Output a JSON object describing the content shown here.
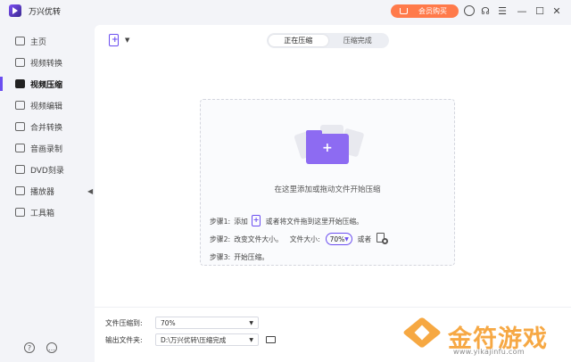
{
  "app": {
    "name": "万兴优转"
  },
  "titlebar": {
    "vip_label": "会员购买"
  },
  "sidebar": {
    "items": [
      {
        "label": "主页",
        "icon": "home-icon"
      },
      {
        "label": "视频转换",
        "icon": "convert-icon"
      },
      {
        "label": "视频压缩",
        "icon": "compress-icon",
        "active": true
      },
      {
        "label": "视频编辑",
        "icon": "scissors-icon"
      },
      {
        "label": "合并转换",
        "icon": "merge-icon"
      },
      {
        "label": "音画录制",
        "icon": "record-icon"
      },
      {
        "label": "DVD刻录",
        "icon": "disc-icon"
      },
      {
        "label": "播放器",
        "icon": "player-icon"
      },
      {
        "label": "工具箱",
        "icon": "toolbox-icon"
      }
    ]
  },
  "main": {
    "tabs": [
      {
        "label": "正在压缩",
        "active": true
      },
      {
        "label": "压缩完成",
        "active": false
      }
    ],
    "drop_hint": "在这里添加或拖动文件开始压缩",
    "steps": {
      "step1_label": "步骤1:",
      "step1_pre": "添加",
      "step1_post": "或者将文件拖到这里开始压缩。",
      "step2_label": "步骤2:",
      "step2_text": "改变文件大小。",
      "step2_size_label": "文件大小:",
      "step2_size_value": "70%",
      "step2_or": "或者",
      "step3_label": "步骤3:",
      "step3_text": "开始压缩。"
    },
    "bottom": {
      "compress_to_label": "文件压缩到:",
      "compress_to_value": "70%",
      "output_label": "输出文件夹:",
      "output_value": "D:\\万兴优转\\压缩完成"
    }
  },
  "watermark": {
    "title": "金符游戏",
    "url": "www.yikajinfu.com"
  },
  "colors": {
    "accent": "#6b4ef0",
    "vip": "#ff7a4a",
    "watermark": "#f6a43a"
  }
}
